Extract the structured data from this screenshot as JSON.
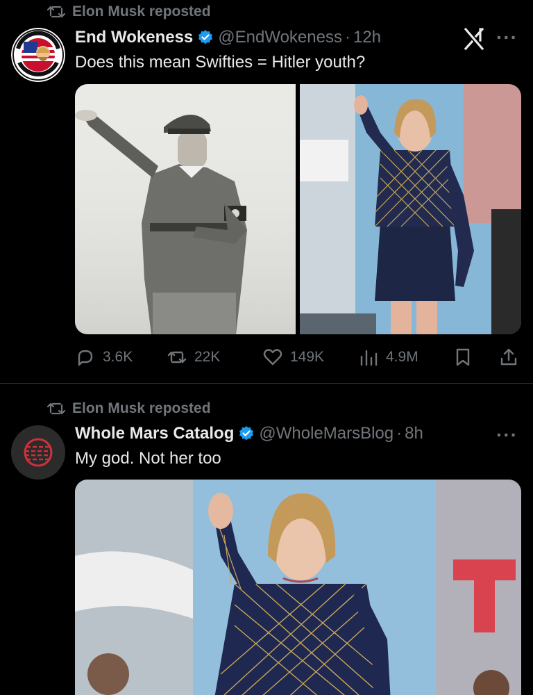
{
  "posts": [
    {
      "repost_label": "Elon Musk reposted",
      "author_name": "End Wokeness",
      "handle": "@EndWokeness",
      "separator": "·",
      "time": "12h",
      "text": "Does this mean Swifties = Hitler youth?",
      "more_label": "···",
      "metrics": {
        "replies": "3.6K",
        "reposts": "22K",
        "likes": "149K",
        "views": "4.9M"
      },
      "media": [
        {
          "alt_icon": "photo-black-and-white-salute"
        },
        {
          "alt_icon": "photo-performer-waving"
        }
      ]
    },
    {
      "repost_label": "Elon Musk reposted",
      "author_name": "Whole Mars Catalog",
      "handle": "@WholeMarsBlog",
      "separator": "·",
      "time": "8h",
      "text": "My god. Not her too",
      "more_label": "···",
      "media": [
        {
          "alt_icon": "photo-performer-waving-closeup"
        }
      ]
    }
  ],
  "colors": {
    "background": "#000000",
    "primary_text": "#e7e9ea",
    "secondary_text": "#71767b",
    "verified": "#1d9bf0",
    "divider": "#2f3336"
  }
}
